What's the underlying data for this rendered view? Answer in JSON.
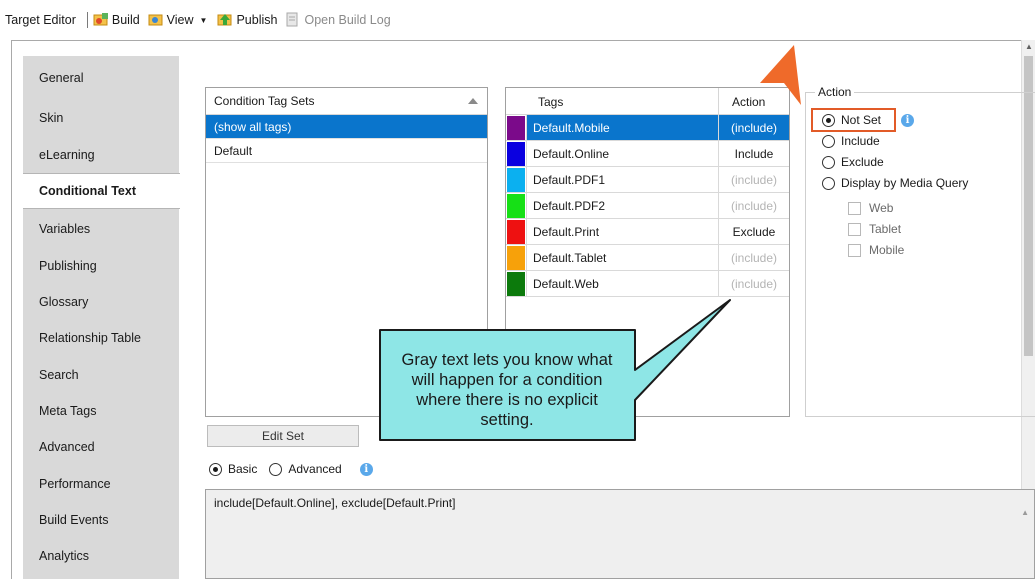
{
  "toolbar": {
    "title": "Target Editor",
    "build": "Build",
    "view": "View",
    "publish": "Publish",
    "open_build_log": "Open Build Log"
  },
  "tabs": [
    {
      "label": "General"
    },
    {
      "label": "Skin"
    },
    {
      "label": "eLearning"
    },
    {
      "label": "Conditional Text"
    },
    {
      "label": "Variables"
    },
    {
      "label": "Publishing"
    },
    {
      "label": "Glossary"
    },
    {
      "label": "Relationship Table"
    },
    {
      "label": "Search"
    },
    {
      "label": "Meta Tags"
    },
    {
      "label": "Advanced"
    },
    {
      "label": "Performance"
    },
    {
      "label": "Build Events"
    },
    {
      "label": "Analytics"
    }
  ],
  "condition_tag_sets": {
    "header": "Condition Tag Sets",
    "rows": [
      "(show all tags)",
      "Default"
    ]
  },
  "tags_table": {
    "header_tags": "Tags",
    "header_action": "Action",
    "rows": [
      {
        "name": "Default.Mobile",
        "action": "(include)",
        "color": "#7b0a8a"
      },
      {
        "name": "Default.Online",
        "action": "Include",
        "color": "#0a00e0"
      },
      {
        "name": "Default.PDF1",
        "action": "(include)",
        "color": "#0bb0f0"
      },
      {
        "name": "Default.PDF2",
        "action": "(include)",
        "color": "#16e016"
      },
      {
        "name": "Default.Print",
        "action": "Exclude",
        "color": "#ee1111"
      },
      {
        "name": "Default.Tablet",
        "action": "(include)",
        "color": "#f7a10a"
      },
      {
        "name": "Default.Web",
        "action": "(include)",
        "color": "#0c7a0c"
      }
    ]
  },
  "action_group": {
    "legend": "Action",
    "options": [
      "Not Set",
      "Include",
      "Exclude",
      "Display by Media Query"
    ],
    "media": [
      "Web",
      "Tablet",
      "Mobile"
    ]
  },
  "edit_set": "Edit Set",
  "mode": {
    "basic": "Basic",
    "advanced": "Advanced"
  },
  "expression": "include[Default.Online], exclude[Default.Print]",
  "callout": "Gray text lets you know what will happen for a condition where there is no explicit setting.",
  "colors": {
    "accent": "#0a75cc",
    "callout_fill": "#8ee6e6",
    "highlight": "#e25b28"
  }
}
